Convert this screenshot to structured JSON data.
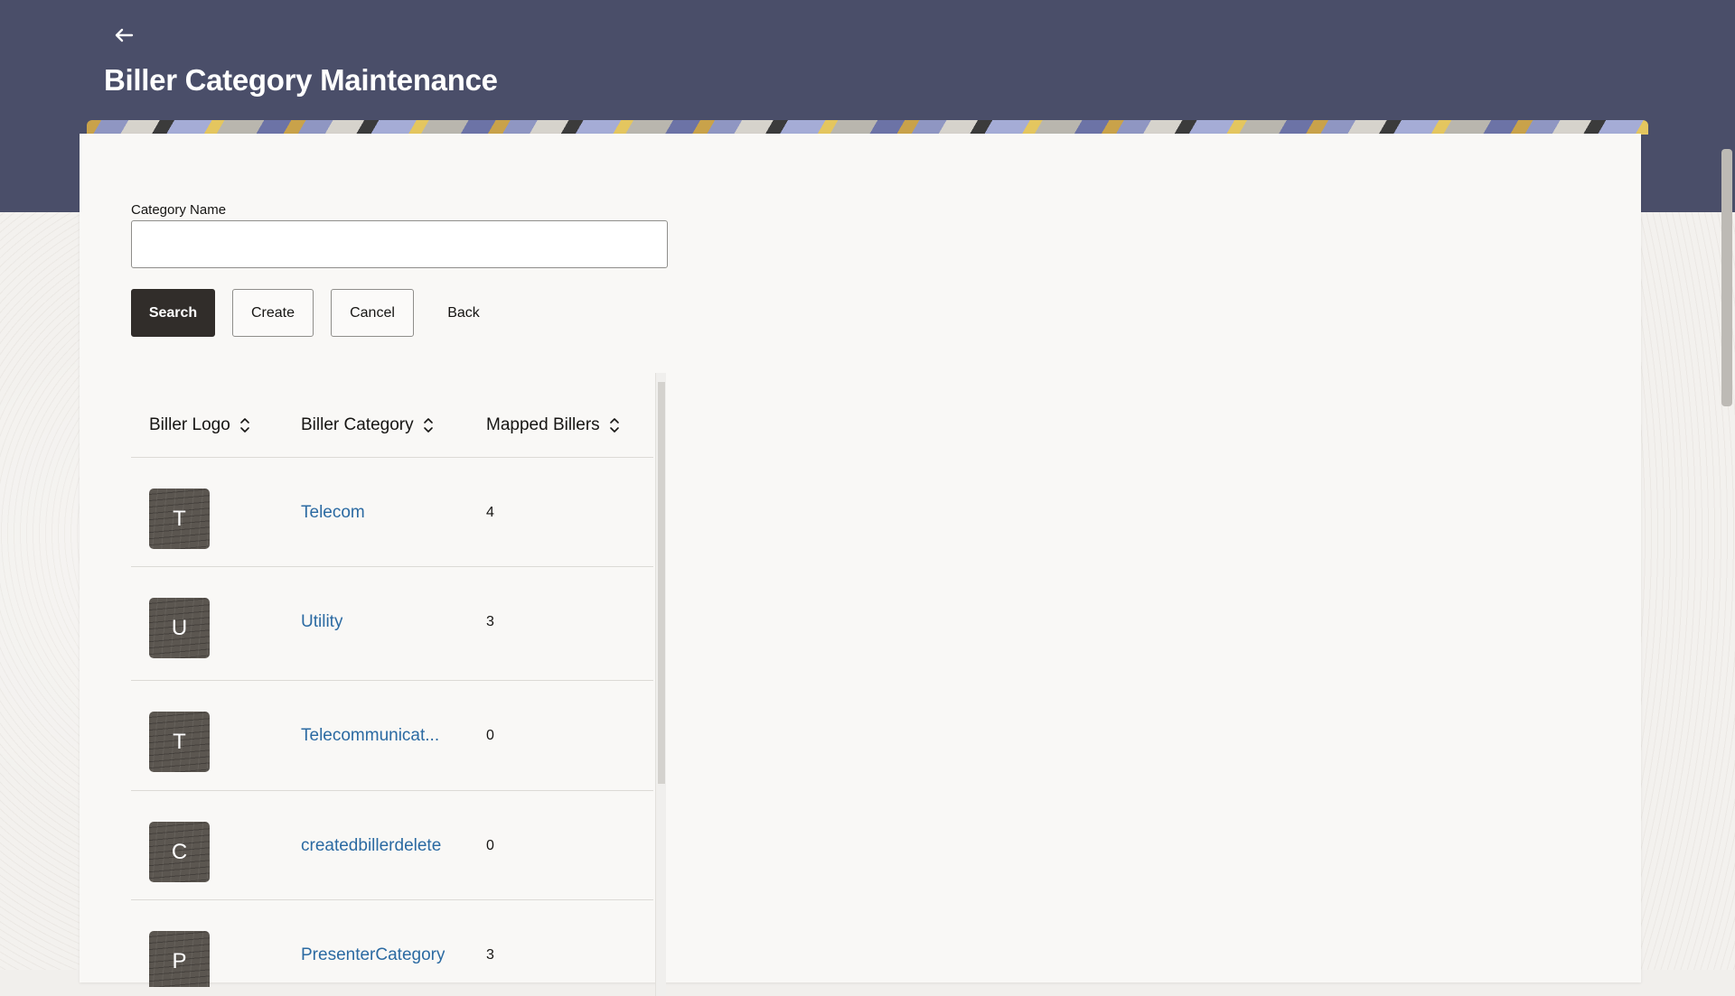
{
  "header": {
    "title": "Biller Category Maintenance",
    "back_icon": "arrow-left-icon"
  },
  "form": {
    "category_name_label": "Category Name",
    "category_name_value": "",
    "category_name_placeholder": ""
  },
  "buttons": {
    "search": "Search",
    "create": "Create",
    "cancel": "Cancel",
    "back": "Back"
  },
  "table": {
    "columns": [
      "Biller Logo",
      "Biller Category",
      "Mapped Billers"
    ],
    "rows": [
      {
        "logo_letter": "T",
        "category": "Telecom",
        "mapped": "4"
      },
      {
        "logo_letter": "U",
        "category": "Utility",
        "mapped": "3"
      },
      {
        "logo_letter": "T",
        "category": "Telecommunicat...",
        "mapped": "0"
      },
      {
        "logo_letter": "C",
        "category": "createdbillerdelete",
        "mapped": "0"
      },
      {
        "logo_letter": "P",
        "category": "PresenterCategory",
        "mapped": "3"
      }
    ]
  },
  "colors": {
    "header_bg": "#4a4e69",
    "primary_button": "#312d2a",
    "link": "#2b6aa2"
  }
}
